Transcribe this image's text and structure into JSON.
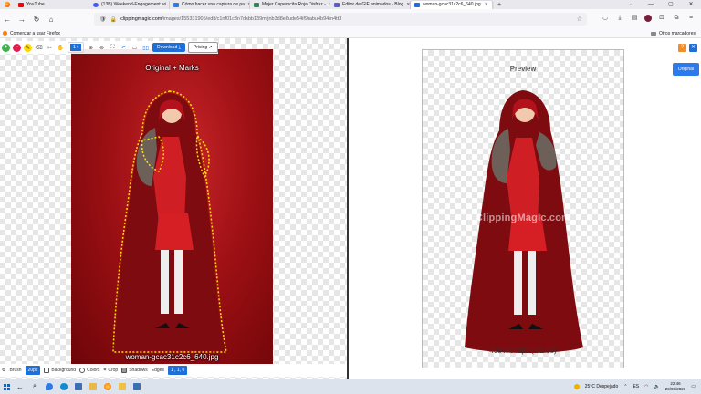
{
  "browser": {
    "tabs": [
      {
        "label": "YouTube",
        "color": "#ff0000"
      },
      {
        "label": "(13B) Weekend-Engagement wi",
        "color": "#4255ff"
      },
      {
        "label": "Cómo hacer una captura de pa",
        "color": "#2d7bea"
      },
      {
        "label": "Mujer Caperucita Roja Disfraz -",
        "color": "#2e8b57"
      },
      {
        "label": "Editor de GIF animados - Blog",
        "color": "#5b5bd6"
      },
      {
        "label": "woman-gcac31c2c6_640.jpg",
        "color": "#1e6fd9"
      }
    ],
    "new_tab": "+",
    "url_host": "clippingmagic.com",
    "url_rest": "/images/155331905/edit/c1nf01c3n7dsbb139mfjnb3d8e8ude54if9rabu4b94rn4tt3",
    "bookmarks_left": "Comenzar a usar Firefox",
    "bookmarks_right": "Otros marcadores"
  },
  "toolbar": {
    "zoom_label": "1+",
    "download_label": "Download",
    "pricing_label": "Pricing"
  },
  "left_panel": {
    "title": "Original + Marks",
    "filename": "woman-gcac31c2c6_640.jpg"
  },
  "right_panel": {
    "title": "Preview",
    "watermark": "ClippingMagic.com",
    "dimensions": "405 x 640px (1:1.58)",
    "original_button": "Original"
  },
  "bottom_toolbar": {
    "brush_label": "Brush",
    "brush_size": "20px",
    "background_label": "Background",
    "colors_label": "Colors",
    "crop_label": "Crop",
    "shadows_label": "Shadows",
    "edges_label": "Edges",
    "edges_value": "1 , 1, 0"
  },
  "taskbar": {
    "weather": "25°C  Despejado",
    "language": "ES",
    "time": "22:46",
    "date": "29/06/2023"
  }
}
